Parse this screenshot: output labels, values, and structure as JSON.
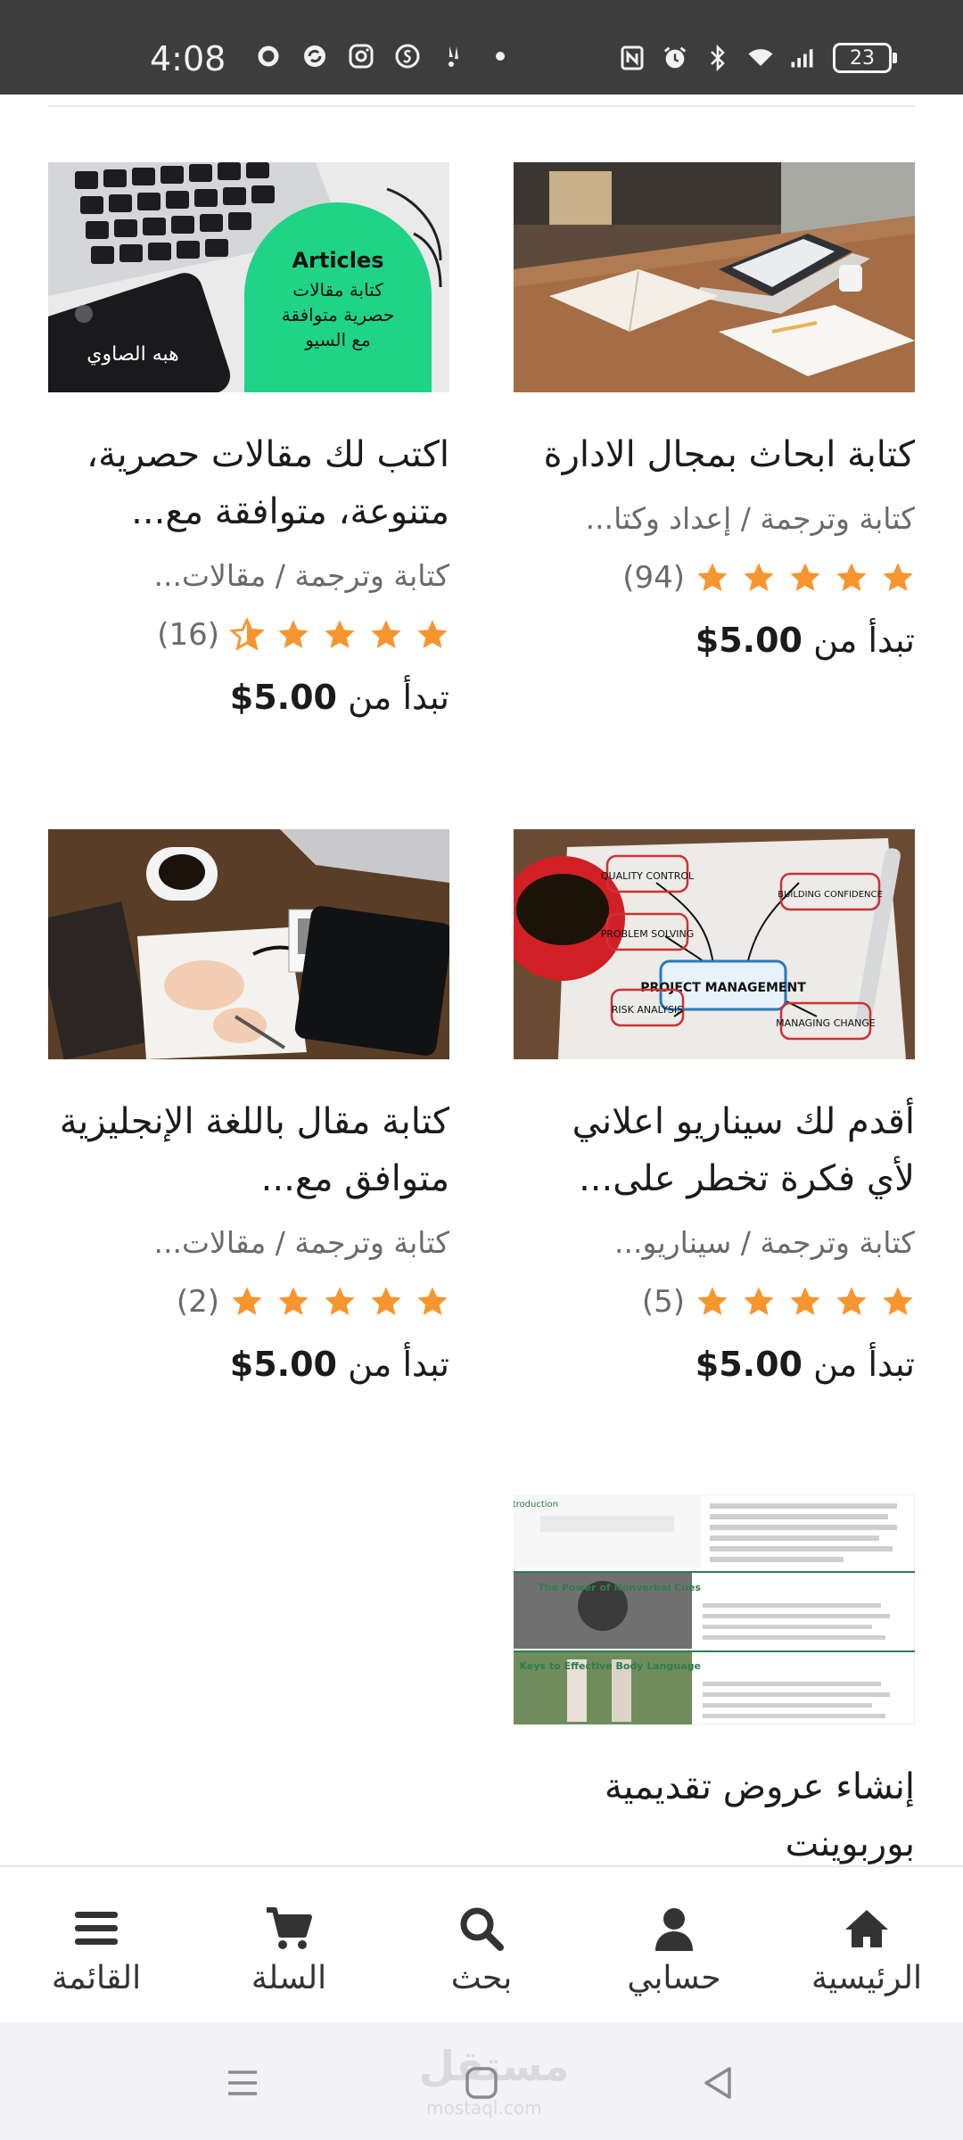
{
  "status_bar": {
    "time": "4:08",
    "battery": "23",
    "left_icons": [
      "o-icon",
      "sync-icon",
      "instagram-icon",
      "shazam-icon",
      "snapchat-icon",
      "dot-icon"
    ],
    "right_icons": [
      "nfc-icon",
      "alarm-icon",
      "bluetooth-icon",
      "wifi-icon",
      "signal-icon"
    ]
  },
  "cards": [
    {
      "title": "كتابة ابحاث بمجال الادارة",
      "category": "كتابة وترجمة",
      "subcategory": "إعداد وكتا...",
      "rating": 5,
      "rating_count": "(94)",
      "price_prefix": "تبدأ من",
      "price": "$5.00",
      "image": "desk-laptop-notebook"
    },
    {
      "title": "اكتب لك مقالات حصرية، متنوعة، متوافقة مع...",
      "category": "كتابة وترجمة",
      "subcategory": "مقالات...",
      "rating": 4.5,
      "rating_count": "(16)",
      "price_prefix": "تبدأ من",
      "price": "$5.00",
      "image": "laptop-articles",
      "image_text": {
        "badge_title": "Articles",
        "badge_line1": "كتابة مقالات",
        "badge_line2": "حصرية متوافقة",
        "badge_line3": "مع السيو",
        "phone_text": "هبه الصاوي"
      }
    },
    {
      "title": "أقدم لك سيناريو اعلاني لأي فكرة تخطر على...",
      "category": "كتابة وترجمة",
      "subcategory": "سيناريو...",
      "rating": 5,
      "rating_count": "(5)",
      "price_prefix": "تبدأ من",
      "price": "$5.00",
      "image": "project-management-sketch",
      "image_text": {
        "center": "PROJECT MANAGEMENT",
        "n1": "QUALITY CONTROL",
        "n2": "BUILDING CONFIDENCE",
        "n3": "PROBLEM SOLVING",
        "n4": "RISK ANALYSIS",
        "n5": "MANAGING CHANGE"
      }
    },
    {
      "title": "كتابة مقال باللغة الإنجليزية متوافق مع...",
      "category": "كتابة وترجمة",
      "subcategory": "مقالات...",
      "rating": 5,
      "rating_count": "(2)",
      "price_prefix": "تبدأ من",
      "price": "$5.00",
      "image": "desk-writing-notebook"
    },
    {
      "title": "إنشاء عروض تقديمية بوربوينت",
      "image": "slides-preview",
      "image_text": {
        "heading": "Introduction",
        "slide2": "The Power of Nonverbal Cues",
        "slide3": "Keys to Effective Body Language"
      }
    }
  ],
  "bottom_nav": [
    {
      "label": "الرئيسية",
      "icon": "home-icon"
    },
    {
      "label": "حسابي",
      "icon": "user-icon"
    },
    {
      "label": "بحث",
      "icon": "search-icon"
    },
    {
      "label": "السلة",
      "icon": "cart-icon"
    },
    {
      "label": "القائمة",
      "icon": "menu-icon"
    }
  ],
  "watermark": "مستقل",
  "watermark_sub": "mostaql.com",
  "colors": {
    "star": "#f7952f",
    "status_bar": "#3d3d3d",
    "text": "#1b1b1b",
    "muted": "#6a6a6a"
  }
}
